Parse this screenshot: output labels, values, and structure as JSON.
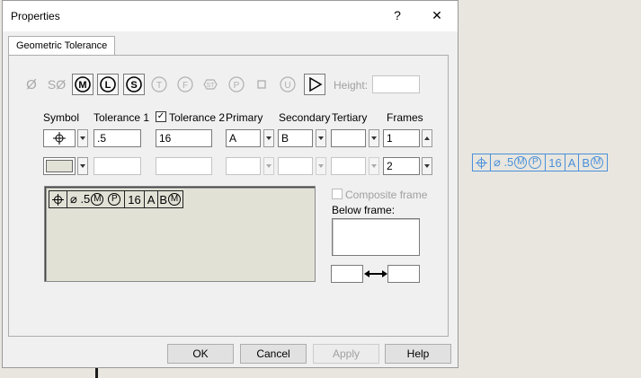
{
  "dialog": {
    "title": "Properties",
    "help_label": "?",
    "close_label": "✕",
    "tab_label": "Geometric Tolerance"
  },
  "toolbar": {
    "buttons": [
      {
        "name": "diameter-icon",
        "glyph": "Ø",
        "enabled": false
      },
      {
        "name": "spherical-diameter-icon",
        "glyph": "SØ",
        "enabled": false
      },
      {
        "name": "mmc-icon",
        "glyph": "M",
        "enabled": true
      },
      {
        "name": "lmc-icon",
        "glyph": "L",
        "enabled": true
      },
      {
        "name": "rfs-icon",
        "glyph": "S",
        "enabled": true
      },
      {
        "name": "tangent-plane-icon",
        "glyph": "T",
        "enabled": false
      },
      {
        "name": "free-state-icon",
        "glyph": "F",
        "enabled": false
      },
      {
        "name": "statistical-icon",
        "glyph": "ST",
        "enabled": false
      },
      {
        "name": "projected-zone-icon",
        "glyph": "P",
        "enabled": false
      },
      {
        "name": "square-icon",
        "glyph": "□",
        "enabled": false
      },
      {
        "name": "unequal-profile-icon",
        "glyph": "U",
        "enabled": false
      },
      {
        "name": "all-around-icon",
        "glyph": "▷",
        "enabled": true
      }
    ],
    "height_label": "Height:",
    "height_value": ""
  },
  "columns": {
    "symbol": "Symbol",
    "tolerance1": "Tolerance 1",
    "tolerance2": "Tolerance 2",
    "primary": "Primary",
    "secondary": "Secondary",
    "tertiary": "Tertiary",
    "frames": "Frames"
  },
  "row1": {
    "symbol": "position-symbol",
    "tolerance1": ".5",
    "tolerance2": "16",
    "tolerance2_checked": true,
    "primary": "A",
    "secondary": "B",
    "tertiary": "",
    "frames": "1"
  },
  "row2": {
    "symbol": "",
    "tolerance1": "",
    "tolerance2": "",
    "primary": "",
    "secondary": "",
    "tertiary": "",
    "frames": "2"
  },
  "preview_frame": {
    "tol1": "⌀ .5",
    "mod_m": "M",
    "mod_p": "P",
    "tol2": "16",
    "datum_a": "A",
    "datum_b": "B",
    "datum_b_mod": "M"
  },
  "side": {
    "composite_label": "Composite frame",
    "composite_checked": false,
    "below_frame_label": "Below frame:",
    "below_frame_value": "",
    "left_value": "",
    "right_value": ""
  },
  "buttons": {
    "ok": "OK",
    "cancel": "Cancel",
    "apply": "Apply",
    "help": "Help"
  },
  "canvas_frame": {
    "tol1": "⌀ .5",
    "mod_m": "M",
    "mod_p": "P",
    "tol2": "16",
    "datum_a": "A",
    "datum_b": "B",
    "datum_b_mod": "M"
  },
  "colors": {
    "cad_blue": "#4a90d9",
    "preview_bg": "#e2e1d6",
    "workspace_bg": "#e8e6df"
  }
}
